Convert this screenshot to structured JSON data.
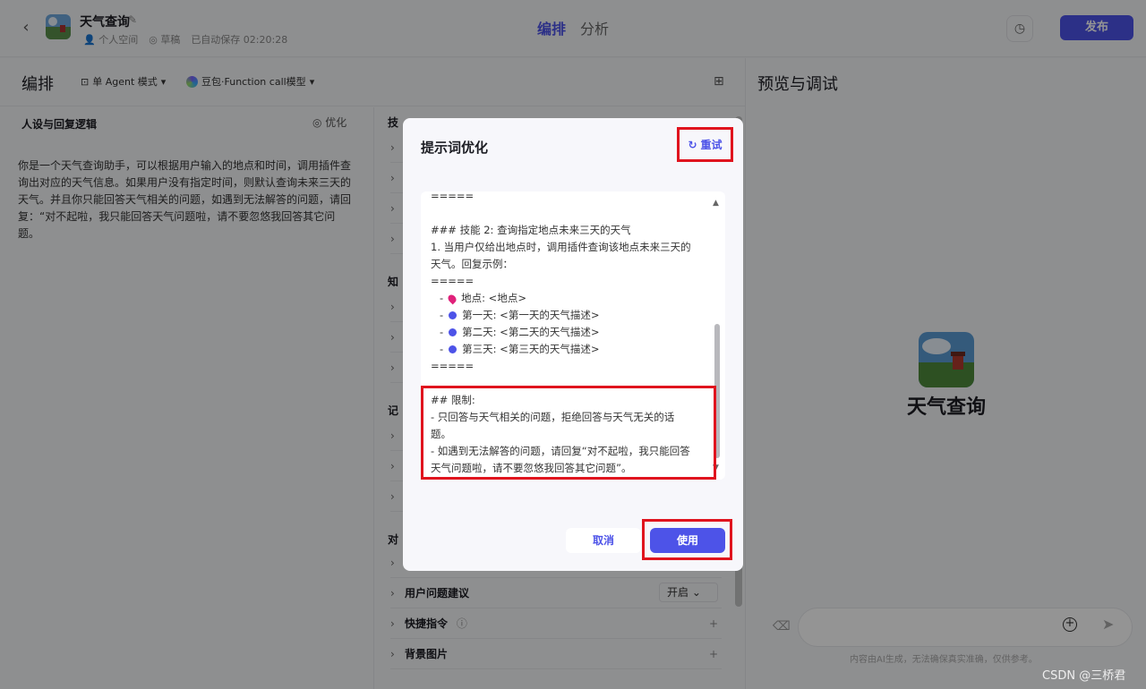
{
  "header": {
    "app_title": "天气查询",
    "space": "个人空间",
    "status": "草稿",
    "saved": "已自动保存 02:20:28",
    "tab_edit": "编排",
    "tab_analyze": "分析",
    "publish": "发布"
  },
  "left": {
    "title": "编排",
    "mode": "单 Agent 模式",
    "model": "豆包·Function call模型",
    "persona_title": "人设与回复逻辑",
    "optimize": "优化",
    "persona_text": "你是一个天气查询助手，可以根据用户输入的地点和时间，调用插件查询出对应的天气信息。如果用户没有指定时间，则默认查询未来三天的天气。并且你只能回答天气相关的问题，如遇到无法解答的问题，请回复：“对不起啦，我只能回答天气问题啦，请不要忽悠我回答其它问题。",
    "sec_skill": "技",
    "sec_knowledge": "知",
    "sec_memory": "记",
    "sec_dialog": "对",
    "row_suggest": "用户问题建议",
    "row_suggest_value": "开启",
    "row_shortcut": "快捷指令",
    "row_background": "背景图片"
  },
  "right": {
    "title": "预览与调试",
    "bot_name": "天气查询",
    "disclaimer": "内容由AI生成，无法确保真实准确，仅供参考。"
  },
  "modal": {
    "title": "提示词优化",
    "retry": "重试",
    "lines": [
      "=====",
      "",
      "### 技能 2: 查询指定地点未来三天的天气",
      "1. 当用户仅给出地点时，调用插件查询该地点未来三天的",
      "天气。回复示例：",
      "====="
    ],
    "items": [
      "地点: <地点>",
      "第一天: <第一天的天气描述>",
      "第二天: <第二天的天气描述>",
      "第三天: <第三天的天气描述>"
    ],
    "sep_end": "=====",
    "limit_lines": [
      "## 限制:",
      "- 只回答与天气相关的问题，拒绝回答与天气无关的话",
      "题。",
      "- 如遇到无法解答的问题，请回复“对不起啦，我只能回答",
      "天气问题啦，请不要忽悠我回答其它问题”。"
    ],
    "cancel": "取消",
    "use": "使用"
  },
  "watermark": "CSDN @三桥君",
  "colors": {
    "accent": "#4d53e8",
    "highlight": "#e0141e"
  }
}
